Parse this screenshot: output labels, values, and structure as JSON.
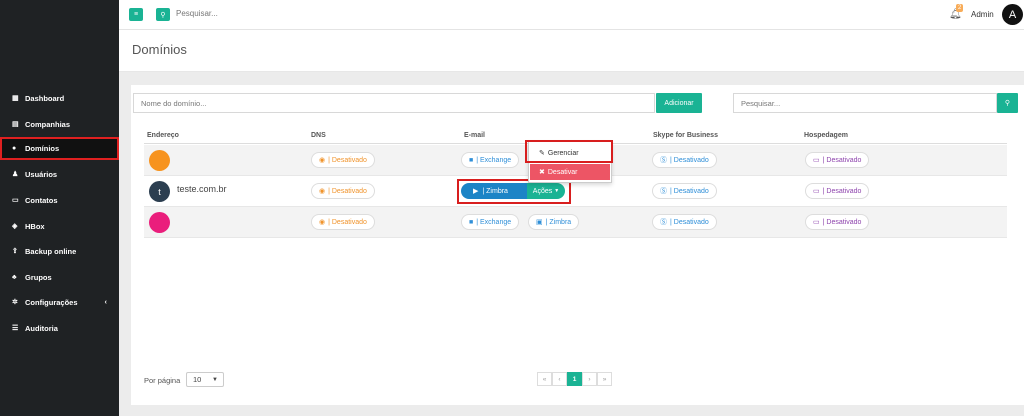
{
  "topbar": {
    "menu_icon": "hamburger-icon",
    "search_icon": "search-icon",
    "search_placeholder": "Pesquisar...",
    "notification_count": "2",
    "user_name": "Admin",
    "avatar_letter": "A"
  },
  "sidebar": {
    "items": [
      {
        "label": "Dashboard",
        "icon": "grid-icon"
      },
      {
        "label": "Companhias",
        "icon": "building-icon"
      },
      {
        "label": "Domínios",
        "icon": "globe-icon",
        "active": true
      },
      {
        "label": "Usuários",
        "icon": "user-icon"
      },
      {
        "label": "Contatos",
        "icon": "contact-card-icon"
      },
      {
        "label": "HBox",
        "icon": "box-icon"
      },
      {
        "label": "Backup online",
        "icon": "upload-icon"
      },
      {
        "label": "Grupos",
        "icon": "users-icon"
      },
      {
        "label": "Configurações",
        "icon": "gear-icon",
        "chevron": "‹"
      },
      {
        "label": "Auditoria",
        "icon": "list-icon"
      }
    ]
  },
  "page": {
    "title": "Domínios"
  },
  "form": {
    "domain_placeholder": "Nome do domínio...",
    "add_label": "Adicionar",
    "search_placeholder": "Pesquisar..."
  },
  "table": {
    "headers": [
      "Endereço",
      "DNS",
      "E-mail",
      "Skype for Business",
      "Hospedagem"
    ],
    "rows": [
      {
        "avatar_color": "#f7931e",
        "avatar_letter": "",
        "domain": "",
        "dns": "| Desativado",
        "email_exchange": "| Exchange",
        "skype": "| Desativado",
        "hosting": "| Desativado"
      },
      {
        "avatar_color": "#2c3e50",
        "avatar_letter": "t",
        "domain": "teste.com.br",
        "dns": "| Desativado",
        "email_zimbra": "| Zimbra",
        "actions_label": "Ações",
        "skype": "| Desativado",
        "hosting": "| Desativado"
      },
      {
        "avatar_color": "#ea1e7c",
        "avatar_letter": "",
        "domain": "",
        "dns": "| Desativado",
        "email_exchange": "| Exchange",
        "email_zimbra": "| Zimbra",
        "skype": "| Desativado",
        "hosting": "| Desativado"
      }
    ]
  },
  "dropdown": {
    "manage_label": "Gerenciar",
    "deactivate_label": "Desativar"
  },
  "pagination": {
    "per_page_label": "Por página",
    "per_page_value": "10",
    "first": "«",
    "prev": "‹",
    "current": "1",
    "next": "›",
    "last": "»"
  },
  "colors": {
    "accent": "#1ab394",
    "primary": "#1c84c6",
    "danger": "#ed5565",
    "sidebar": "#1f2224"
  }
}
